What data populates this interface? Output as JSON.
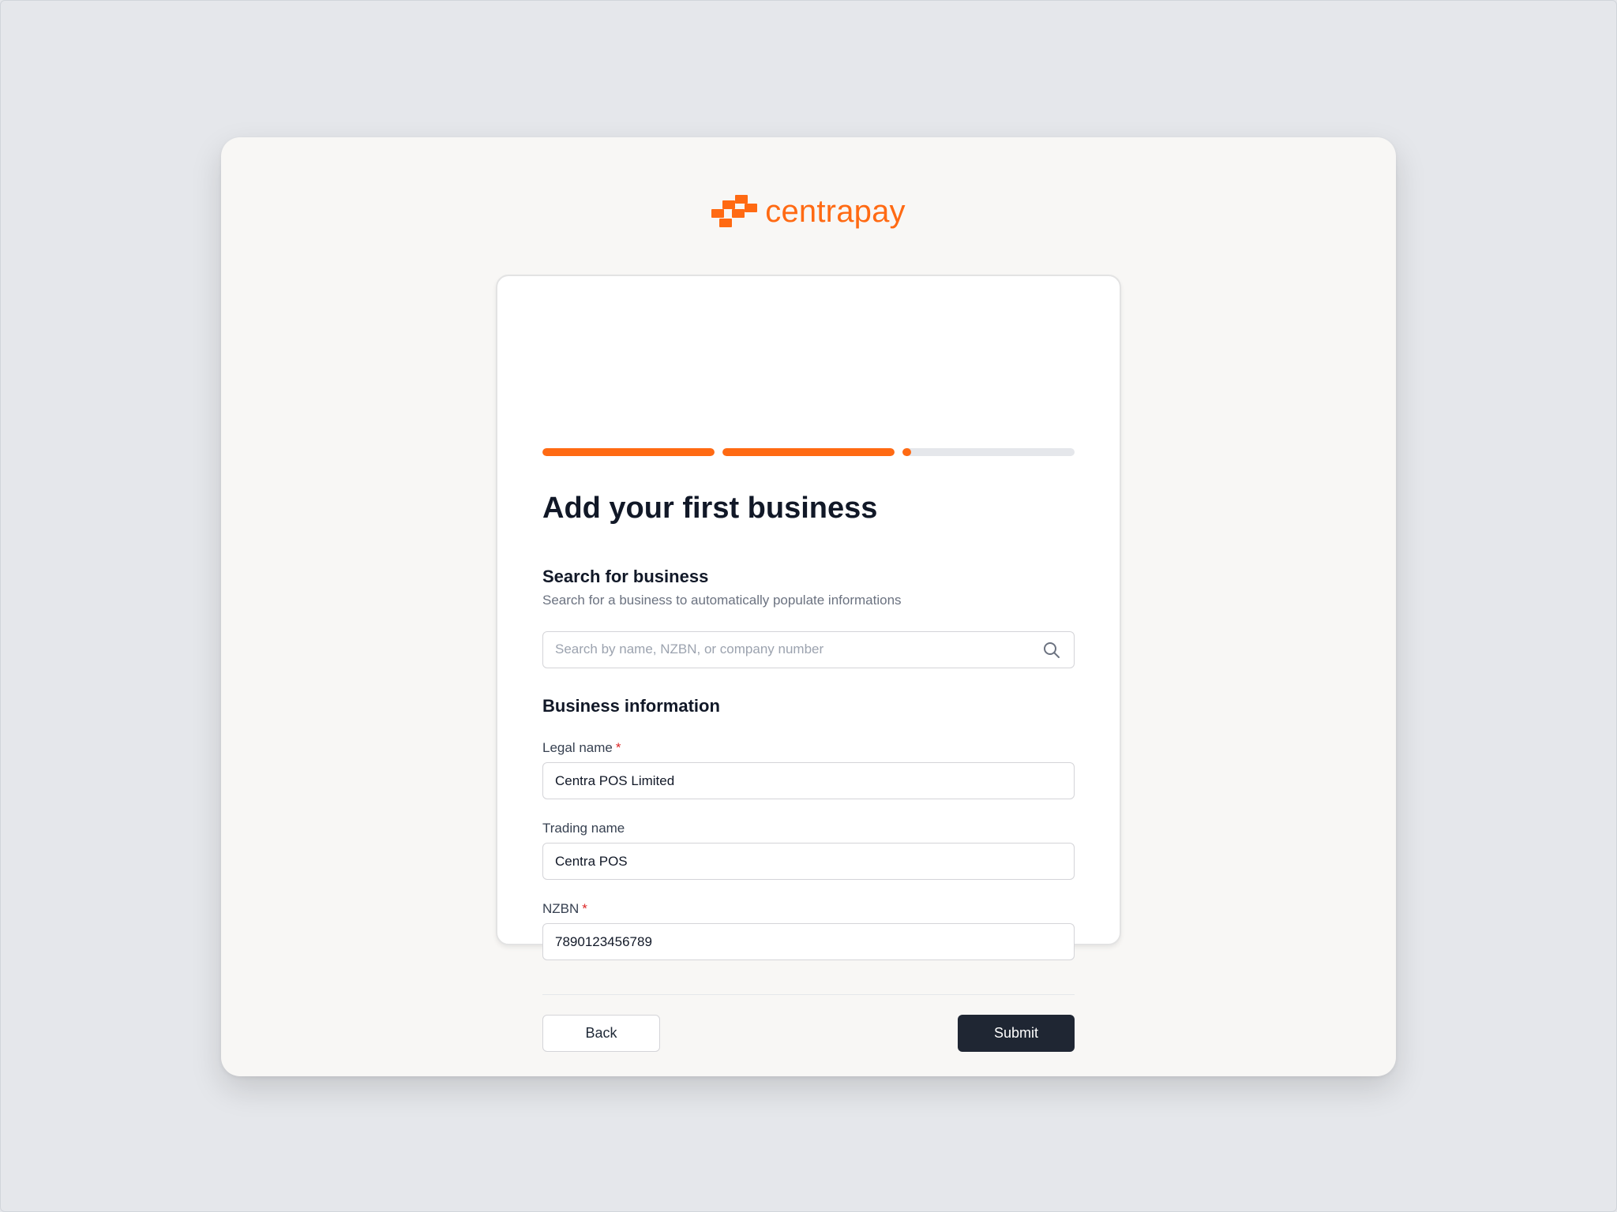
{
  "brand": {
    "name": "centrapay",
    "logo_icon": "centrapay-logo-icon",
    "color": "#ff6a13"
  },
  "progress": {
    "steps": [
      {
        "fill": 1.0
      },
      {
        "fill": 1.0
      },
      {
        "fill": 0.05
      }
    ],
    "active_color": "#ff6a13",
    "track_color": "#e5e7eb"
  },
  "form": {
    "title": "Add your first business",
    "search_section": {
      "title": "Search for business",
      "description": "Search for a business to automatically populate informations",
      "placeholder": "Search by name, NZBN, or company number",
      "value": "",
      "icon": "search-icon"
    },
    "info_section": {
      "title": "Business information"
    },
    "fields": {
      "legal_name": {
        "label": "Legal name",
        "required_marker": "*",
        "value": "Centra POS Limited"
      },
      "trading_name": {
        "label": "Trading name",
        "value": "Centra POS"
      },
      "nzbn": {
        "label": "NZBN",
        "required_marker": "*",
        "value": "7890123456789"
      }
    },
    "buttons": {
      "back": "Back",
      "submit": "Submit"
    }
  }
}
